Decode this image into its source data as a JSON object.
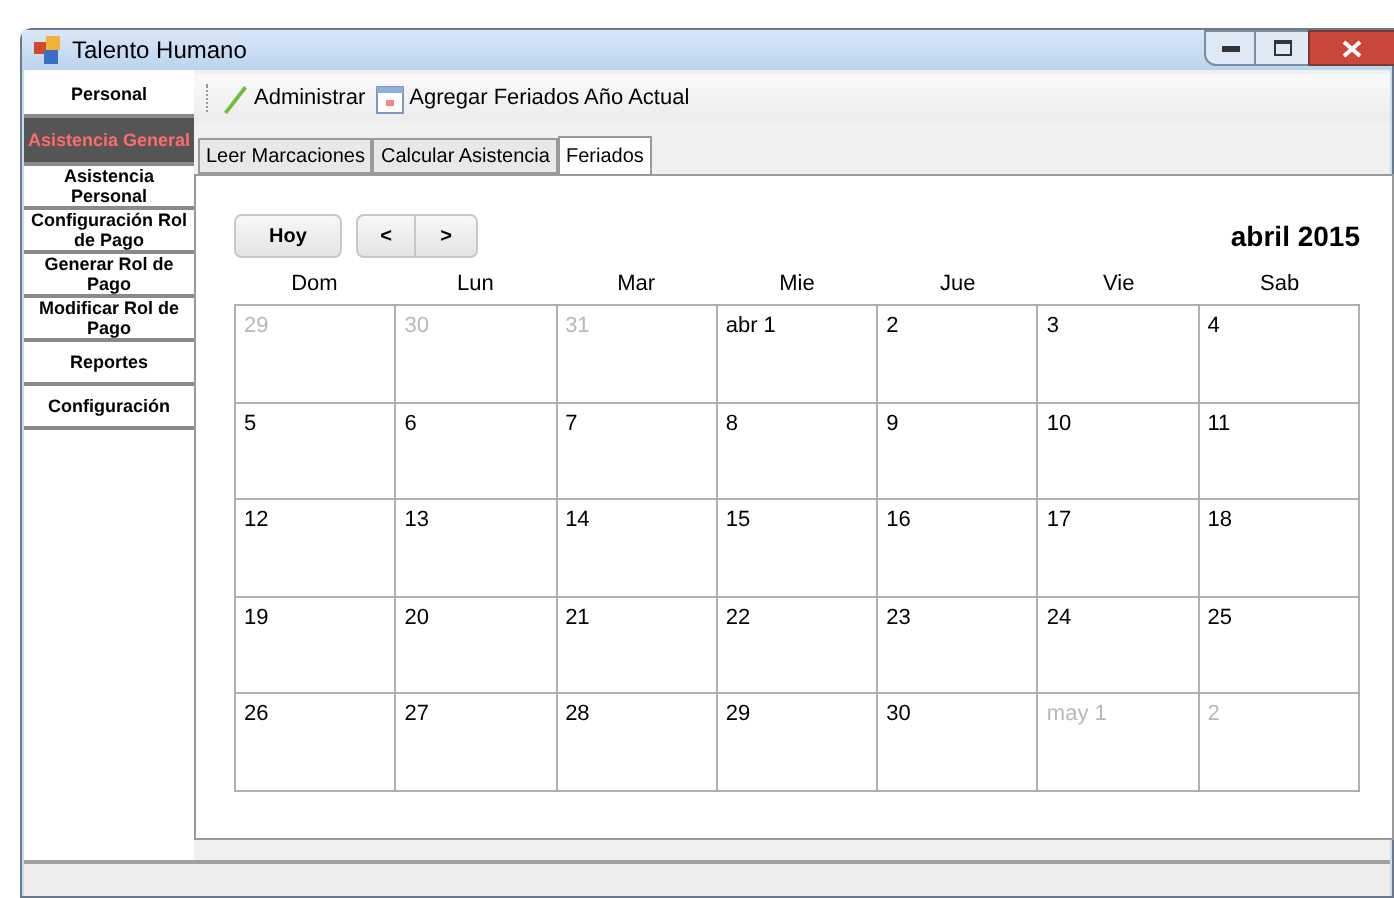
{
  "window": {
    "title": "Talento Humano"
  },
  "sidebar": {
    "items": [
      {
        "label": "Personal",
        "selected": false
      },
      {
        "label": "Asistencia General",
        "selected": true
      },
      {
        "label": "Asistencia Personal",
        "selected": false
      },
      {
        "label": "Configuración Rol de Pago",
        "selected": false
      },
      {
        "label": "Generar Rol de Pago",
        "selected": false
      },
      {
        "label": "Modificar Rol de Pago",
        "selected": false
      },
      {
        "label": "Reportes",
        "selected": false
      },
      {
        "label": "Configuración",
        "selected": false
      }
    ]
  },
  "toolbar": [
    {
      "label": "Administrar",
      "kind": "pencil"
    },
    {
      "label": "Agregar Feriados Año Actual",
      "kind": "calendar"
    }
  ],
  "tabs": [
    {
      "label": "Leer Marcaciones",
      "selected": false
    },
    {
      "label": "Calcular Asistencia",
      "selected": false
    },
    {
      "label": "Feriados",
      "selected": true
    }
  ],
  "calendar": {
    "today_button": "Hoy",
    "prev_button": "<",
    "next_button": ">",
    "month": "abril 2015",
    "weekdays": [
      "Dom",
      "Lun",
      "Mar",
      "Mie",
      "Jue",
      "Vie",
      "Sab"
    ],
    "weeks": [
      [
        {
          "label": "29",
          "muted": true
        },
        {
          "label": "30",
          "muted": true
        },
        {
          "label": "31",
          "muted": true
        },
        {
          "label": "abr 1",
          "muted": false
        },
        {
          "label": "2",
          "muted": false
        },
        {
          "label": "3",
          "muted": false
        },
        {
          "label": "4",
          "muted": false
        }
      ],
      [
        {
          "label": "5",
          "muted": false
        },
        {
          "label": "6",
          "muted": false
        },
        {
          "label": "7",
          "muted": false
        },
        {
          "label": "8",
          "muted": false
        },
        {
          "label": "9",
          "muted": false
        },
        {
          "label": "10",
          "muted": false
        },
        {
          "label": "11",
          "muted": false
        }
      ],
      [
        {
          "label": "12",
          "muted": false
        },
        {
          "label": "13",
          "muted": false
        },
        {
          "label": "14",
          "muted": false
        },
        {
          "label": "15",
          "muted": false
        },
        {
          "label": "16",
          "muted": false
        },
        {
          "label": "17",
          "muted": false
        },
        {
          "label": "18",
          "muted": false
        }
      ],
      [
        {
          "label": "19",
          "muted": false
        },
        {
          "label": "20",
          "muted": false
        },
        {
          "label": "21",
          "muted": false
        },
        {
          "label": "22",
          "muted": false
        },
        {
          "label": "23",
          "muted": false
        },
        {
          "label": "24",
          "muted": false
        },
        {
          "label": "25",
          "muted": false
        }
      ],
      [
        {
          "label": "26",
          "muted": false
        },
        {
          "label": "27",
          "muted": false
        },
        {
          "label": "28",
          "muted": false
        },
        {
          "label": "29",
          "muted": false
        },
        {
          "label": "30",
          "muted": false
        },
        {
          "label": "may 1",
          "muted": true
        },
        {
          "label": "2",
          "muted": true
        }
      ]
    ]
  }
}
